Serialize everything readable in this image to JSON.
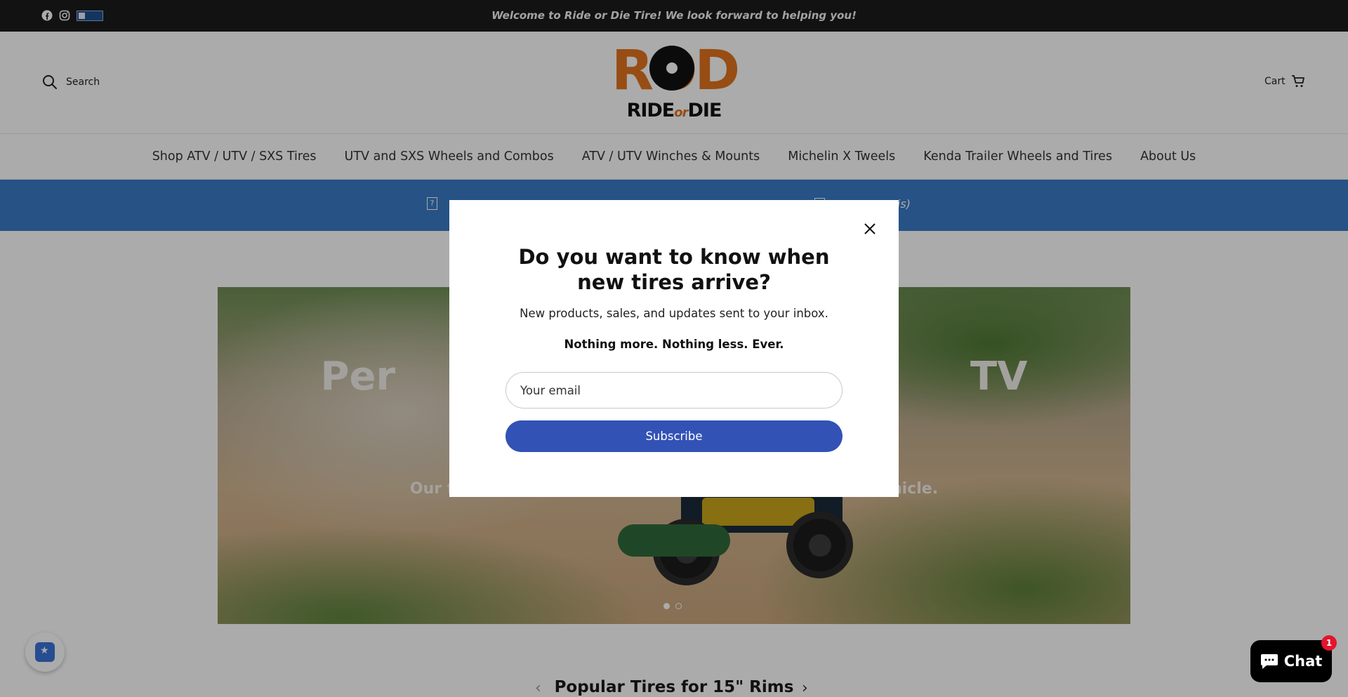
{
  "announcement": {
    "message": "Welcome to Ride or Die Tire! We look forward to helping you!",
    "social_icons": [
      "facebook-icon",
      "instagram-icon",
      "business-badge-icon"
    ]
  },
  "header": {
    "search_label": "Search",
    "logo_main": "ROD",
    "logo_sub_left": "RIDE",
    "logo_sub_mid": "or",
    "logo_sub_right": "DIE",
    "cart_label": "Cart"
  },
  "nav": {
    "items": [
      "Shop ATV / UTV / SXS Tires",
      "UTV and SXS Wheels and Combos",
      "ATV / UTV Winches & Mounts",
      "Michelin X Tweels",
      "Kenda Trailer Wheels and Tires",
      "About Us"
    ]
  },
  "info_strip": {
    "item_1": "?",
    "item_2": "nois)"
  },
  "hero": {
    "heading": "Per                                          TV",
    "subtext": "Our favorite                                                           oad vehicle.",
    "slides": 2,
    "active_slide": 1
  },
  "popular": {
    "title": "Popular Tires for 15\" Rims",
    "prev": "‹",
    "next": "›"
  },
  "modal": {
    "heading": "Do you want to know when new tires arrive?",
    "description": "New products, sales, and updates sent to your inbox.",
    "tagline": "Nothing more. Nothing less. Ever.",
    "email_placeholder": "Your email",
    "subscribe_label": "Subscribe"
  },
  "chat": {
    "label": "Chat",
    "notification_count": "1"
  },
  "colors": {
    "brand_orange": "#e2741f",
    "subscribe_blue": "#3352b6",
    "info_strip_blue": "#3a7bc6",
    "announcement_bg": "#1b1b1b"
  }
}
